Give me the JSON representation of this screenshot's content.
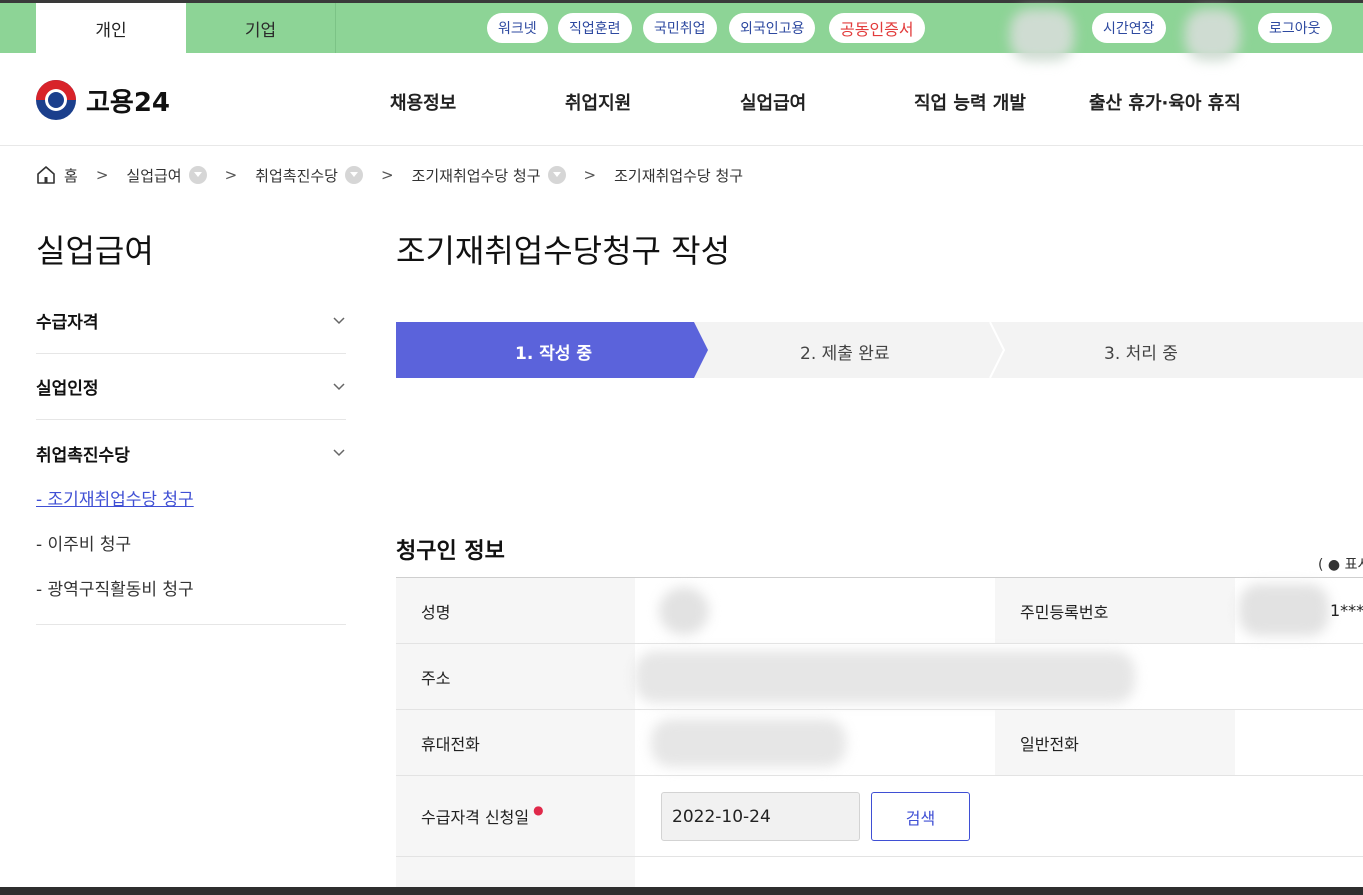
{
  "topbar": {
    "tabs": [
      "개인",
      "기업"
    ],
    "pills": [
      "워크넷",
      "직업훈련",
      "국민취업",
      "외국인고용",
      "공동인증서"
    ],
    "time_extend": "시간연장",
    "logout": "로그아웃",
    "colors": {
      "bar": "#8dd496",
      "pill_text": "#2d49a0",
      "cert_text": "#e23b3b"
    }
  },
  "header": {
    "logo_text": "고용24",
    "menu": [
      "채용정보",
      "취업지원",
      "실업급여",
      "직업 능력 개발",
      "출산 휴가·육아 휴직"
    ]
  },
  "breadcrumb": [
    "홈",
    "실업급여",
    "취업촉진수당",
    "조기재취업수당 청구",
    "조기재취업수당 청구"
  ],
  "sidebar": {
    "title": "실업급여",
    "sections": [
      "수급자격",
      "실업인정",
      "취업촉진수당"
    ],
    "sub_items": [
      "- 조기재취업수당 청구",
      "- 이주비 청구",
      "- 광역구직활동비 청구"
    ],
    "active_index": 0
  },
  "main": {
    "title": "조기재취업수당청구 작성",
    "steps": [
      "1. 작성 중",
      "2. 제출 완료",
      "3. 처리 중"
    ],
    "accent": "#5b63db",
    "section_title": "청구인 정보",
    "legend": "( ● 표시",
    "form": {
      "name_label": "성명",
      "rrn_label": "주민등록번호",
      "rrn_value": "1***",
      "address_label": "주소",
      "mobile_label": "휴대전화",
      "phone_label": "일반전화",
      "apply_date_label": "수급자격 신청일",
      "apply_date_value": "2022-10-24",
      "search_button": "검색"
    }
  }
}
